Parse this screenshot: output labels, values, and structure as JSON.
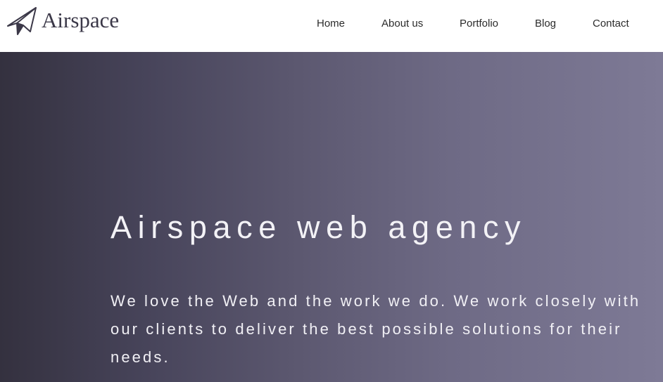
{
  "brand": {
    "name": "Airspace",
    "logo_icon": "paper-plane-icon",
    "logo_color": "#3b3848"
  },
  "nav": {
    "items": [
      {
        "label": "Home"
      },
      {
        "label": "About us"
      },
      {
        "label": "Portfolio"
      },
      {
        "label": "Blog"
      },
      {
        "label": "Contact"
      }
    ]
  },
  "hero": {
    "title": "Airspace web agency",
    "text": "We love the Web and the work we do. We work closely with our clients to deliver the best possible solutions for their needs.",
    "gradient_start": "#34313f",
    "gradient_end": "#7e7a96",
    "text_color": "#f3f2f6"
  }
}
